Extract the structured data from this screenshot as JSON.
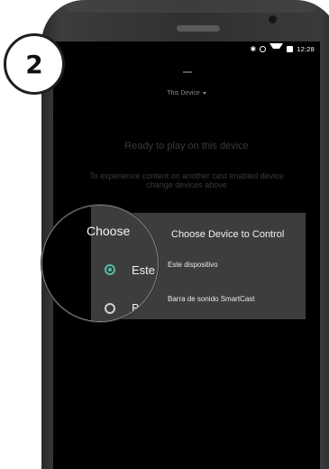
{
  "step": {
    "number": "2"
  },
  "status_bar": {
    "time": "12:28",
    "icons": [
      "bluetooth-icon",
      "sync-icon",
      "wifi-icon",
      "battery-icon"
    ]
  },
  "header": {
    "device_selector": "This Device"
  },
  "main": {
    "ready_title": "Ready to play on this device",
    "ready_description": "To experience content on another cast enabled device change devices above"
  },
  "dialog": {
    "title": "Choose Device to Control",
    "options": [
      {
        "label": "Este dispositivo",
        "selected": true
      },
      {
        "label": "Barra de sonido SmartCast",
        "selected": false
      }
    ]
  },
  "magnifier": {
    "title": "Choose",
    "options": [
      "Este",
      "Bar"
    ]
  },
  "colors": {
    "accent": "#4fc0a4",
    "dialog_bg": "#3d3d3d",
    "screen_bg": "#000000"
  }
}
